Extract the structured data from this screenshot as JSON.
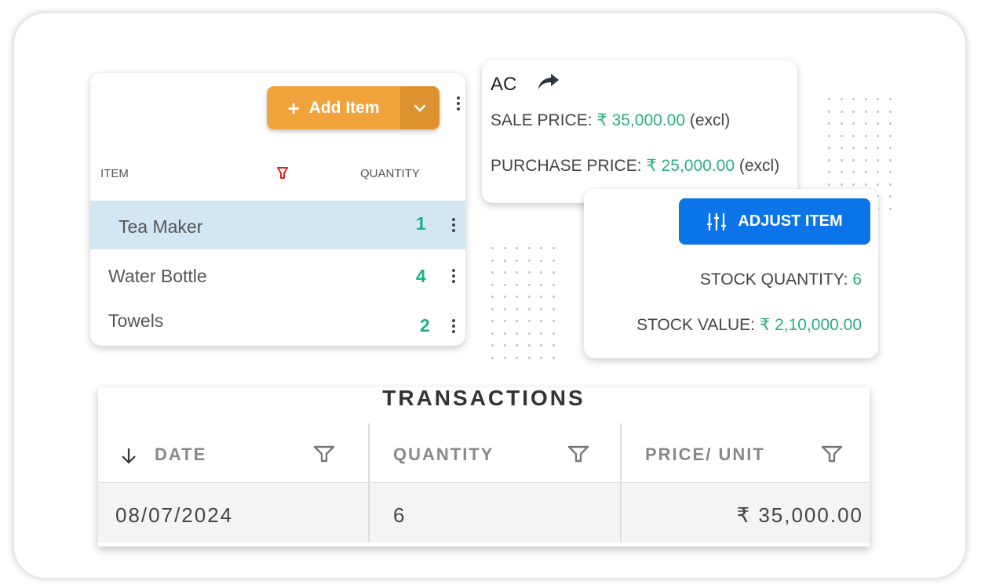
{
  "items_panel": {
    "add_button_label": "Add Item",
    "columns": {
      "item": "ITEM",
      "quantity": "QUANTITY"
    },
    "rows": [
      {
        "name": "Tea Maker",
        "quantity": "1",
        "selected": true
      },
      {
        "name": "Water Bottle",
        "quantity": "4",
        "selected": false
      },
      {
        "name": "Towels",
        "quantity": "2",
        "selected": false
      }
    ]
  },
  "item_detail": {
    "title": "AC",
    "sale_price_label": "SALE PRICE:",
    "sale_price_value": "₹ 35,000.00",
    "sale_price_suffix": "(excl)",
    "purchase_price_label": "PURCHASE PRICE:",
    "purchase_price_value": "₹ 25,000.00",
    "purchase_price_suffix": "(excl)"
  },
  "stock_panel": {
    "adjust_button_label": "ADJUST ITEM",
    "stock_quantity_label": "STOCK QUANTITY:",
    "stock_quantity_value": "6",
    "stock_value_label": "STOCK VALUE:",
    "stock_value_value": "₹ 2,10,000.00"
  },
  "transactions": {
    "title": "TRANSACTIONS",
    "columns": [
      "DATE",
      "QUANTITY",
      "PRICE/ UNIT"
    ],
    "rows": [
      {
        "date": "08/07/2024",
        "quantity": "6",
        "price_per_unit": "₹ 35,000.00"
      }
    ]
  },
  "colors": {
    "accent_orange": "#F0A23B",
    "accent_blue": "#0A74E8",
    "value_green": "#2AAE82",
    "filter_red": "#E02020",
    "selected_row": "#D2E7F1"
  }
}
